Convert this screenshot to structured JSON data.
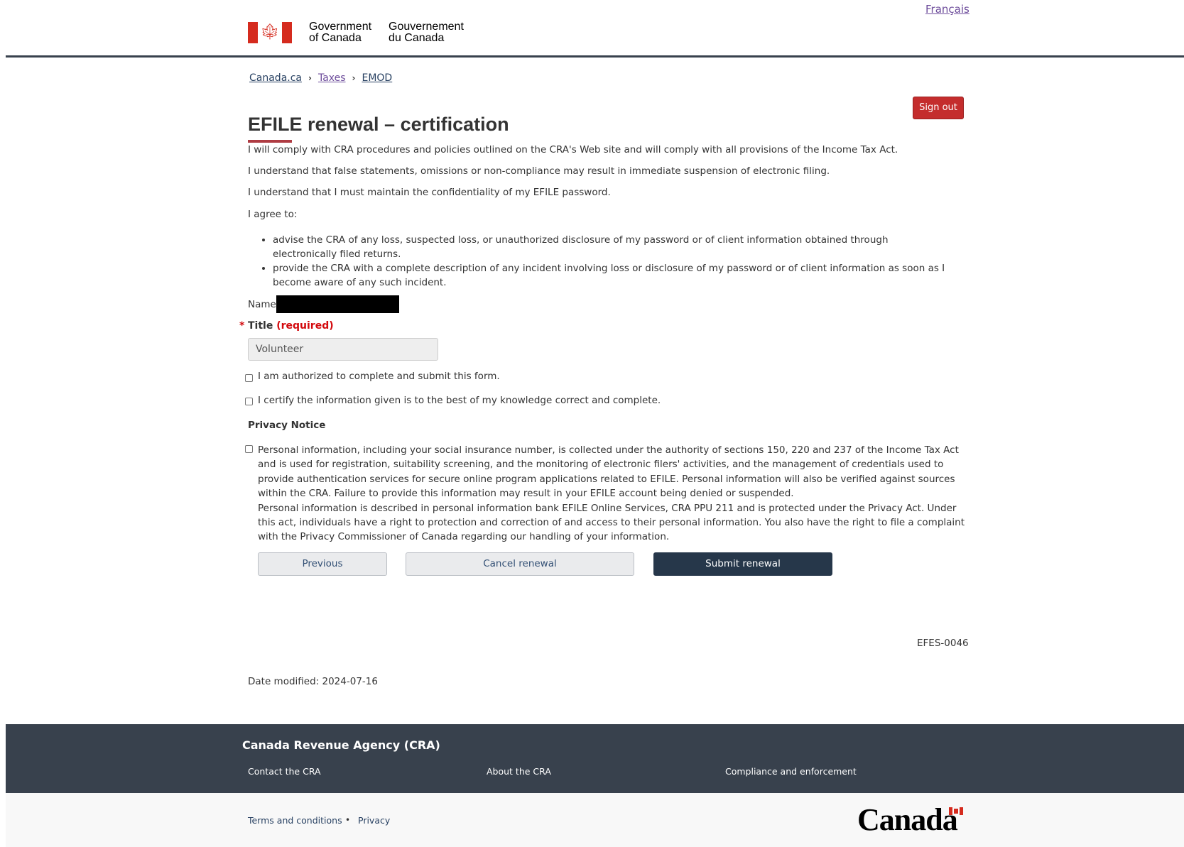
{
  "header": {
    "language_link": "Français",
    "signature_en_line1": "Government",
    "signature_en_line2": "of Canada",
    "signature_fr_line1": "Gouvernement",
    "signature_fr_line2": "du Canada"
  },
  "breadcrumb": [
    "Canada.ca",
    "Taxes",
    "EMOD"
  ],
  "signout_label": "Sign out",
  "page_title": "EFILE renewal – certification",
  "paragraphs": [
    "I will comply with CRA procedures and policies outlined on the CRA's Web site and will comply with all provisions of the Income Tax Act.",
    "I understand that false statements, omissions or non-compliance may result in immediate suspension of electronic filing.",
    "I understand that I must maintain the confidentiality of my EFILE password.",
    "I agree to:"
  ],
  "agree_items": [
    "advise the CRA of any loss, suspected loss, or unauthorized disclosure of my password or of client information obtained through electronically filed returns.",
    "provide the CRA with a complete description of any incident involving loss or disclosure of my password or of client information as soon as I become aware of any such incident."
  ],
  "form": {
    "name_label": "Name",
    "title_required_marker": "*",
    "title_label": "Title",
    "title_required_text": "(required)",
    "title_value": "Volunteer",
    "checkbox_authorized": "I am authorized to complete and submit this form.",
    "checkbox_certify": "I certify the information given is to the best of my knowledge correct and complete.",
    "privacy_heading": "Privacy Notice",
    "privacy_paragraph_1": "Personal information, including your social insurance number, is collected under the authority of sections 150, 220 and 237 of the Income Tax Act and is used for registration, suitability screening, and the monitoring of electronic filers' activities, and the management of credentials used to provide authentication services for secure online program applications related to EFILE. Personal information will also be verified against sources within the CRA. Failure to provide this information may result in your EFILE account being denied or suspended.",
    "privacy_paragraph_2": "Personal information is described in personal information bank EFILE Online Services, CRA PPU 211 and is protected under the Privacy Act. Under this act, individuals have a right to protection and correction of and access to their personal information. You also have the right to file a complaint with the Privacy Commissioner of Canada regarding our handling of your information."
  },
  "buttons": {
    "previous": "Previous",
    "cancel": "Cancel renewal",
    "submit": "Submit renewal"
  },
  "page_id": "EFES-0046",
  "date_modified": "Date modified: 2024-07-16",
  "footer": {
    "title": "Canada Revenue Agency (CRA)",
    "links": [
      "Contact the CRA",
      "About the CRA",
      "Compliance and enforcement"
    ],
    "sub_links": [
      "Terms and conditions",
      "Privacy"
    ],
    "sub_separator": "•",
    "wordmark": "Canada"
  },
  "colors": {
    "header_rule": "#38414d",
    "title_accent": "#af3c43",
    "signout": "#c42d2d",
    "primary_button": "#26374a",
    "footer_bg": "#38414d"
  }
}
